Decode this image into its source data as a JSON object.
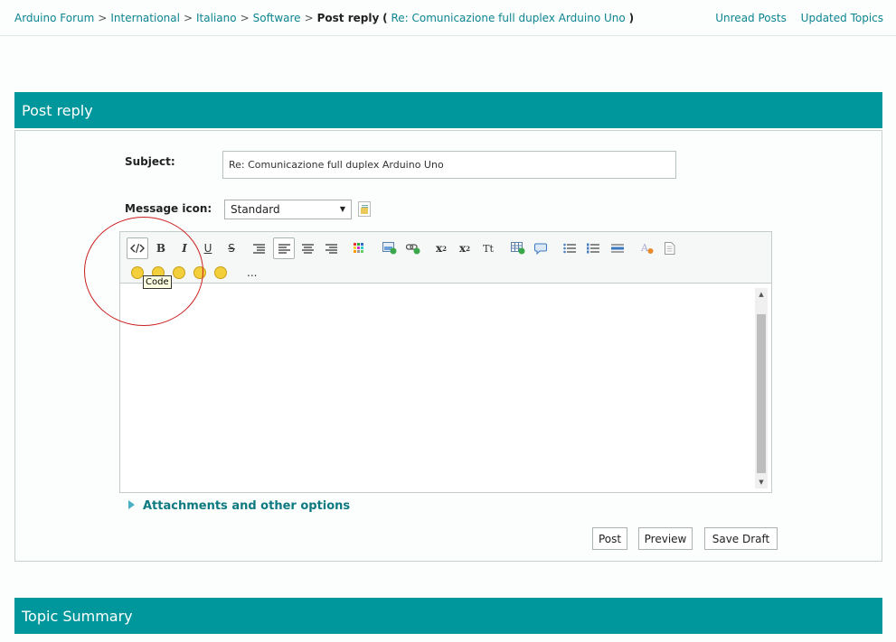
{
  "breadcrumb": {
    "items": [
      "Arduino Forum",
      "International",
      "Italiano",
      "Software"
    ],
    "separator": ">",
    "current": "Post reply",
    "open_paren": "(",
    "topic_link": "Re: Comunicazione full duplex Arduino Uno",
    "close_paren": ")"
  },
  "toplinks": {
    "unread": "Unread Posts",
    "updated": "Updated Topics"
  },
  "section_post": {
    "title": "Post reply"
  },
  "form": {
    "subject_label": "Subject:",
    "subject_value": "Re: Comunicazione full duplex Arduino Uno",
    "icon_label": "Message icon:",
    "icon_selected": "Standard"
  },
  "toolbar": {
    "buttons": {
      "code": "code-icon",
      "bold": "B",
      "italic": "I",
      "underline": "U",
      "strike": "S",
      "superscript_base": "x",
      "superscript_exp": "2",
      "subscript_base": "x",
      "subscript_sub": "2",
      "font_size": "Tt"
    },
    "more": "...",
    "tooltip": "Code"
  },
  "attachments": {
    "label": "Attachments and other options"
  },
  "buttons": {
    "post": "Post",
    "preview": "Preview",
    "save_draft": "Save Draft"
  },
  "section_summary": {
    "title": "Topic Summary"
  },
  "colors": {
    "accent": "#00979c",
    "link": "#0d8590",
    "annotation_circle": "#cc1f1f"
  }
}
